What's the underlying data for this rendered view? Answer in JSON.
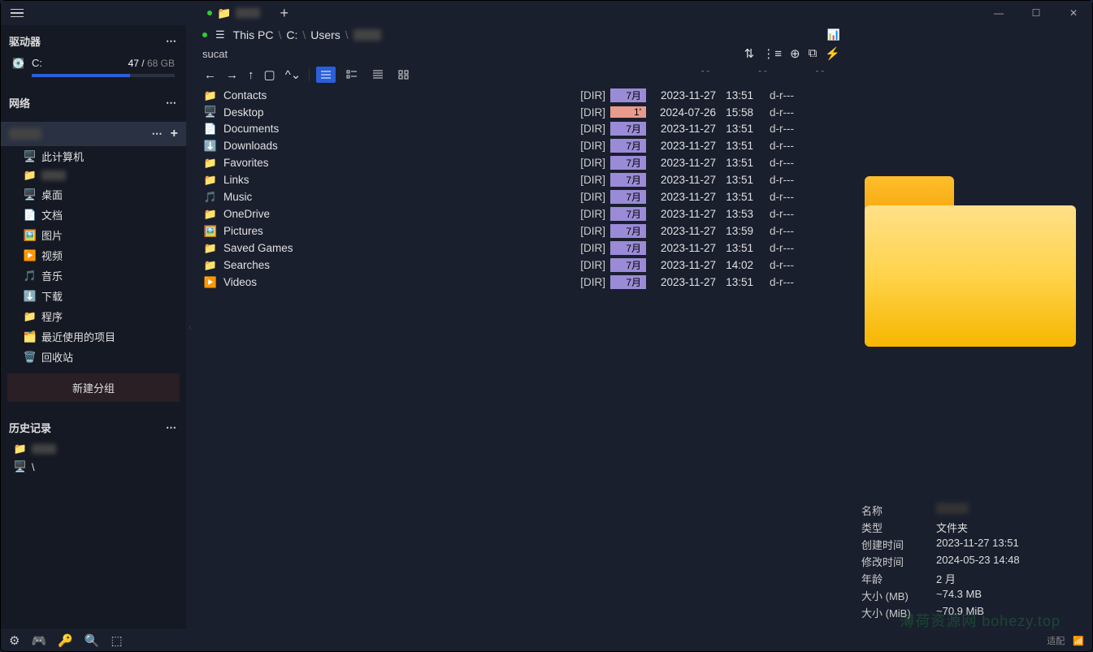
{
  "tab": {
    "label": ""
  },
  "path": {
    "segments": [
      "This PC",
      "C:",
      "Users"
    ],
    "last_blur": true
  },
  "filter": {
    "value": "sucat"
  },
  "win": {
    "min": "—",
    "max": "☐",
    "close": "✕"
  },
  "sidebar": {
    "drives": {
      "title": "驱动器",
      "items": [
        {
          "icon": "💽",
          "label": "C:",
          "used": "47",
          "total": "68 GB",
          "pct": 69
        }
      ]
    },
    "network": {
      "title": "网络"
    },
    "group": {
      "title_blur": true,
      "items": [
        {
          "icon": "🖥️",
          "label": "此计算机"
        },
        {
          "icon": "📁",
          "label": "",
          "blur": true
        },
        {
          "icon": "🖥️",
          "label": "桌面"
        },
        {
          "icon": "📄",
          "label": "文档"
        },
        {
          "icon": "🖼️",
          "label": "图片"
        },
        {
          "icon": "▶️",
          "label": "视频"
        },
        {
          "icon": "🎵",
          "label": "音乐"
        },
        {
          "icon": "⬇️",
          "label": "下载"
        },
        {
          "icon": "📁",
          "label": "程序"
        },
        {
          "icon": "🗂️",
          "label": "最近使用的项目"
        },
        {
          "icon": "🗑️",
          "label": "回收站"
        }
      ],
      "new_group": "新建分组"
    },
    "history": {
      "title": "历史记录",
      "items": [
        {
          "icon": "📁",
          "label": "",
          "blur": true
        },
        {
          "icon": "🖥️",
          "label": "\\"
        }
      ]
    }
  },
  "files": [
    {
      "icon": "📁",
      "name": "Contacts",
      "dir": "[DIR]",
      "age": "7月",
      "date": "2023-11-27",
      "time": "13:51",
      "attr": "d-r---"
    },
    {
      "icon": "🖥️",
      "name": "Desktop",
      "dir": "[DIR]",
      "age": "1'",
      "hot": true,
      "date": "2024-07-26",
      "time": "15:58",
      "attr": "d-r---"
    },
    {
      "icon": "📄",
      "name": "Documents",
      "dir": "[DIR]",
      "age": "7月",
      "date": "2023-11-27",
      "time": "13:51",
      "attr": "d-r---"
    },
    {
      "icon": "⬇️",
      "name": "Downloads",
      "dir": "[DIR]",
      "age": "7月",
      "date": "2023-11-27",
      "time": "13:51",
      "attr": "d-r---"
    },
    {
      "icon": "📁",
      "name": "Favorites",
      "dir": "[DIR]",
      "age": "7月",
      "date": "2023-11-27",
      "time": "13:51",
      "attr": "d-r---"
    },
    {
      "icon": "📁",
      "name": "Links",
      "dir": "[DIR]",
      "age": "7月",
      "date": "2023-11-27",
      "time": "13:51",
      "attr": "d-r---"
    },
    {
      "icon": "🎵",
      "name": "Music",
      "dir": "[DIR]",
      "age": "7月",
      "date": "2023-11-27",
      "time": "13:51",
      "attr": "d-r---"
    },
    {
      "icon": "📁",
      "name": "OneDrive",
      "dir": "[DIR]",
      "age": "7月",
      "date": "2023-11-27",
      "time": "13:53",
      "attr": "d-r---"
    },
    {
      "icon": "🖼️",
      "name": "Pictures",
      "dir": "[DIR]",
      "age": "7月",
      "date": "2023-11-27",
      "time": "13:59",
      "attr": "d-r---"
    },
    {
      "icon": "📁",
      "name": "Saved Games",
      "dir": "[DIR]",
      "age": "7月",
      "date": "2023-11-27",
      "time": "13:51",
      "attr": "d-r---"
    },
    {
      "icon": "📁",
      "name": "Searches",
      "dir": "[DIR]",
      "age": "7月",
      "date": "2023-11-27",
      "time": "14:02",
      "attr": "d-r---"
    },
    {
      "icon": "▶️",
      "name": "Videos",
      "dir": "[DIR]",
      "age": "7月",
      "date": "2023-11-27",
      "time": "13:51",
      "attr": "d-r---"
    }
  ],
  "preview": {
    "rows": [
      {
        "k": "名称",
        "v": "",
        "blur": true
      },
      {
        "k": "类型",
        "v": "文件夹"
      },
      {
        "k": "创建时间",
        "v": "2023-11-27  13:51"
      },
      {
        "k": "修改时间",
        "v": "2024-05-23  14:48"
      },
      {
        "k": "年龄",
        "v": "2 月"
      },
      {
        "k": "大小 (MB)",
        "v": "~74.3 MB"
      },
      {
        "k": "大小 (MiB)",
        "v": "~70.9 MiB"
      }
    ]
  },
  "watermark": "薄荷资源网 bohezy.top",
  "status_right": "适配"
}
